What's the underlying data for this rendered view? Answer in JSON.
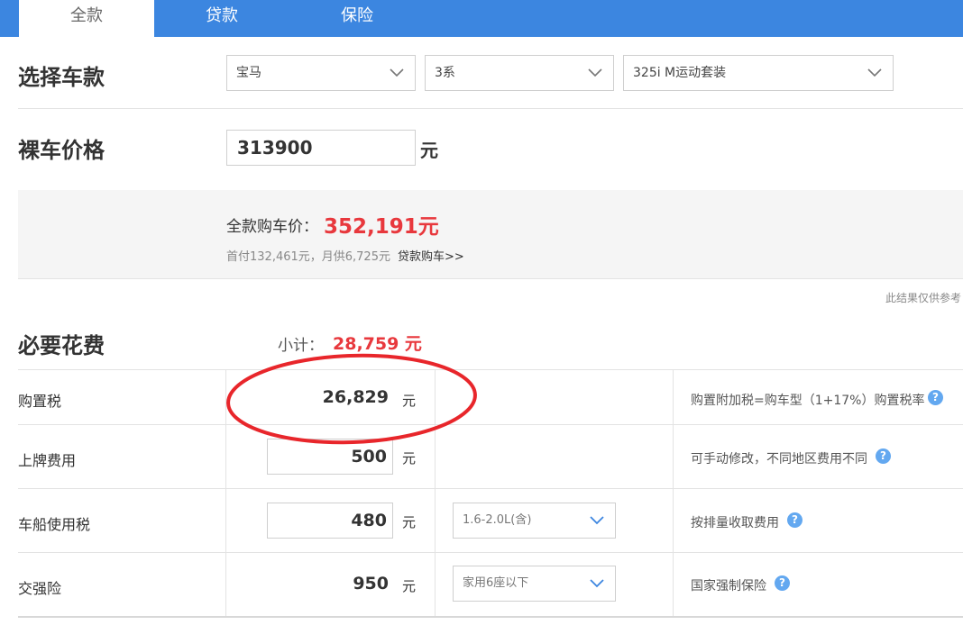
{
  "tabs": [
    {
      "label": "全款",
      "active": true
    },
    {
      "label": "贷款",
      "active": false
    },
    {
      "label": "保险",
      "active": false
    }
  ],
  "select_car": {
    "title": "选择车款",
    "brand": "宝马",
    "series": "3系",
    "model": "325i M运动套装"
  },
  "bare_price": {
    "title": "裸车价格",
    "value": "313900",
    "unit": "元"
  },
  "summary": {
    "full_label": "全款购车价：",
    "full_value": "352,191元",
    "detail": "首付132,461元，月供6,725元",
    "loan_link": "贷款购车>>",
    "disclaimer": "此结果仅供参考"
  },
  "required": {
    "title": "必要花费",
    "subtotal_label": "小计：",
    "subtotal_value": "28,759 元",
    "rows": [
      {
        "label": "购置税",
        "value": "26,829",
        "unit": "元",
        "note": "购置附加税=购车型（1+17%）购置税率"
      },
      {
        "label": "上牌费用",
        "value": "500",
        "unit": "元",
        "note": "可手动修改，不同地区费用不同"
      },
      {
        "label": "车船使用税",
        "value": "480",
        "unit": "元",
        "option": "1.6-2.0L(含)",
        "note": "按排量收取费用"
      },
      {
        "label": "交强险",
        "value": "950",
        "unit": "元",
        "option": "家用6座以下",
        "note": "国家强制保险"
      }
    ]
  },
  "colors": {
    "tab_bar": "#3c86e0",
    "accent_red": "#e8383d",
    "help_icon": "#63a8f0"
  }
}
